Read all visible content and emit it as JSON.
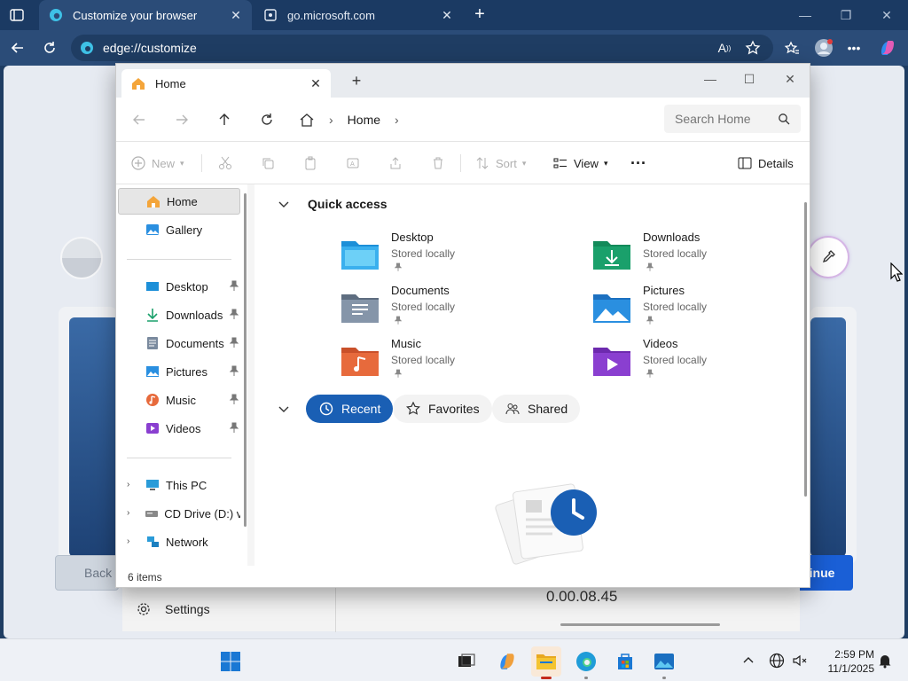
{
  "browser": {
    "tabs": [
      {
        "title": "Customize your browser",
        "active": true
      },
      {
        "title": "go.microsoft.com",
        "active": false
      }
    ],
    "url": "edge://customize"
  },
  "page_behind": {
    "back_label": "Back",
    "continue_label": "tinue",
    "settings_label": "Settings",
    "timer_text": "0.00.08.45"
  },
  "explorer": {
    "tab_title": "Home",
    "breadcrumb": [
      "Home"
    ],
    "search_placeholder": "Search Home",
    "commands": {
      "new": "New",
      "sort": "Sort",
      "view": "View",
      "details": "Details"
    },
    "sidebar": {
      "home": "Home",
      "gallery": "Gallery",
      "pinned": [
        {
          "label": "Desktop",
          "icon": "desktop-icon"
        },
        {
          "label": "Downloads",
          "icon": "downloads-icon"
        },
        {
          "label": "Documents",
          "icon": "documents-icon"
        },
        {
          "label": "Pictures",
          "icon": "pictures-icon"
        },
        {
          "label": "Music",
          "icon": "music-icon"
        },
        {
          "label": "Videos",
          "icon": "videos-icon"
        }
      ],
      "drives": [
        {
          "label": "This PC",
          "icon": "pc-icon"
        },
        {
          "label": "CD Drive (D:) vir",
          "icon": "cd-drive-icon"
        },
        {
          "label": "Network",
          "icon": "network-icon"
        }
      ]
    },
    "quick_access": {
      "title": "Quick access",
      "items": [
        {
          "name": "Desktop",
          "sub": "Stored locally",
          "color": "#1c8fd8"
        },
        {
          "name": "Downloads",
          "sub": "Stored locally",
          "color": "#1aa06b"
        },
        {
          "name": "Documents",
          "sub": "Stored locally",
          "color": "#7a8a9e"
        },
        {
          "name": "Pictures",
          "sub": "Stored locally",
          "color": "#2a8fe0"
        },
        {
          "name": "Music",
          "sub": "Stored locally",
          "color": "#e76a3c"
        },
        {
          "name": "Videos",
          "sub": "Stored locally",
          "color": "#8a3fd0"
        }
      ]
    },
    "filter_pills": [
      "Recent",
      "Favorites",
      "Shared"
    ],
    "status": "6 items"
  },
  "taskbar": {
    "time": "2:59 PM",
    "date": "11/1/2025"
  },
  "colors": {
    "edge_chrome": "#2b4c78",
    "accent_blue": "#1a5fb4",
    "folder_yellow": "#f4c430"
  }
}
